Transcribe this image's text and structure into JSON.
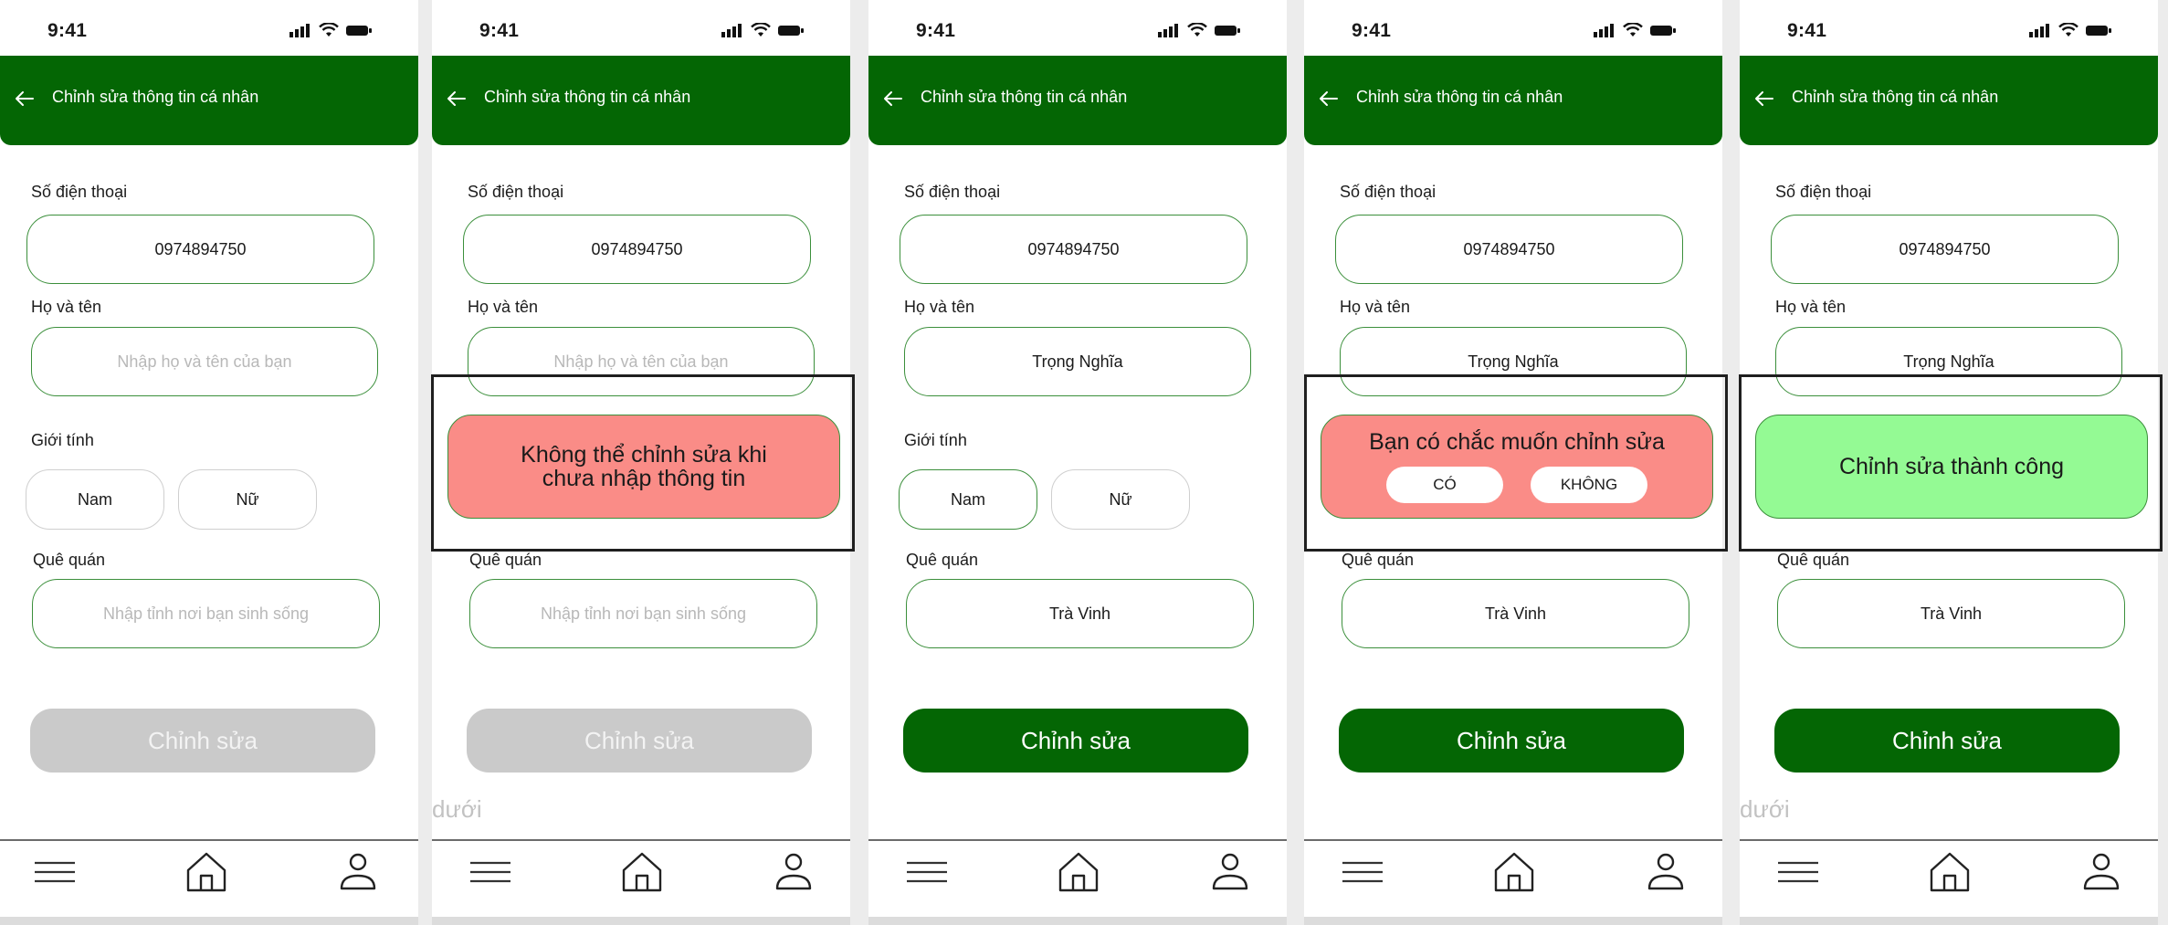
{
  "status": {
    "time": "9:41"
  },
  "header": {
    "title": "Chỉnh sửa thông tin cá nhân"
  },
  "labels": {
    "phone": "Số điện thoại",
    "name": "Họ và tên",
    "gender": "Giới tính",
    "hometown": "Quê quán"
  },
  "gender_options": {
    "male": "Nam",
    "female": "Nữ"
  },
  "submit_label": "Chỉnh sửa",
  "stray_text": "dưới",
  "screens": [
    {
      "phone": "0974894750",
      "name_placeholder": "Nhập họ và tên của bạn",
      "hometown_placeholder": "Nhập tỉnh nơi bạn sinh sống",
      "submit_state": "disabled"
    },
    {
      "phone": "0974894750",
      "name_placeholder": "Nhập họ và tên của bạn",
      "hometown_placeholder": "Nhập tỉnh nơi bạn sinh sống",
      "submit_state": "disabled",
      "dialog": {
        "type": "error",
        "text_line1": "Không thể chỉnh sửa khi",
        "text_line2": "chưa nhập thông tin"
      }
    },
    {
      "phone": "0974894750",
      "name": "Trọng Nghĩa",
      "hometown": "Trà Vinh",
      "selected_gender": "Nam",
      "submit_state": "enabled"
    },
    {
      "phone": "0974894750",
      "name": "Trọng Nghĩa",
      "hometown": "Trà Vinh",
      "submit_state": "enabled",
      "dialog": {
        "type": "confirm",
        "text": "Bạn có chắc muốn chỉnh sửa",
        "yes": "CÓ",
        "no": "KHÔNG"
      }
    },
    {
      "phone": "0974894750",
      "name": "Trọng Nghĩa",
      "hometown": "Trà Vinh",
      "submit_state": "enabled",
      "dialog": {
        "type": "success",
        "text": "Chỉnh sửa thành công"
      }
    }
  ],
  "icons": {
    "back": "arrow-left-icon",
    "menu": "menu-icon",
    "home": "home-icon",
    "profile": "user-icon",
    "signal": "signal-icon",
    "wifi": "wifi-icon",
    "battery": "battery-icon"
  },
  "colors": {
    "primary_green": "#046604",
    "field_border": "#3b8f3b",
    "disabled_button": "#cacaca",
    "error_dialog": "#fa8c87",
    "success_dialog": "#94fa94"
  }
}
